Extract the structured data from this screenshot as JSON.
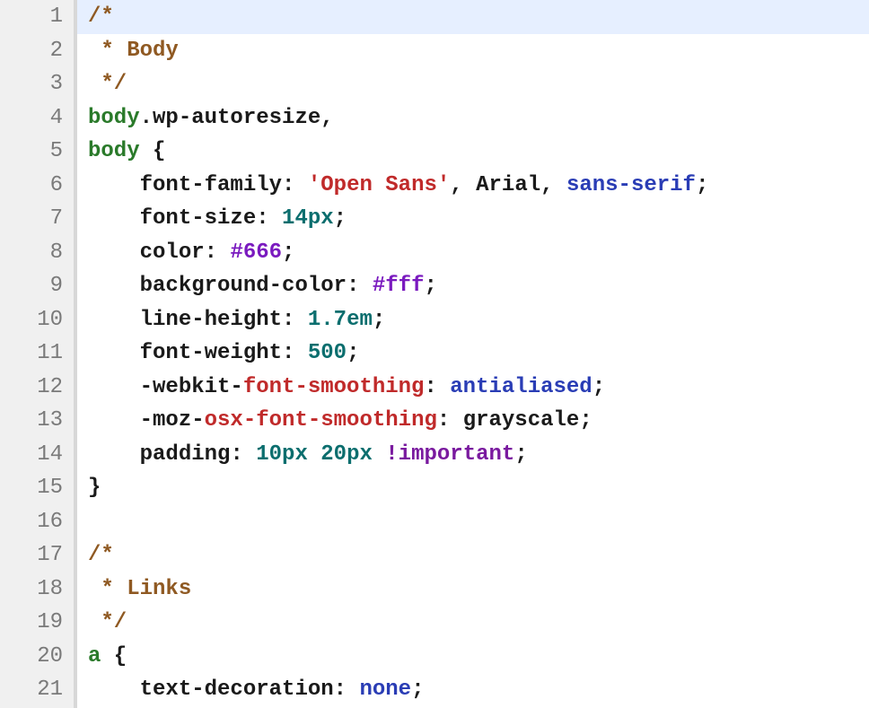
{
  "language": "css",
  "active_line": 1,
  "lines": [
    {
      "num": 1,
      "indent": 0,
      "tokens": [
        {
          "cls": "t-comment",
          "text": "/*"
        }
      ]
    },
    {
      "num": 2,
      "indent": 0,
      "tokens": [
        {
          "cls": "t-comment",
          "text": " * Body"
        }
      ]
    },
    {
      "num": 3,
      "indent": 0,
      "tokens": [
        {
          "cls": "t-comment",
          "text": " */"
        }
      ]
    },
    {
      "num": 4,
      "indent": 0,
      "tokens": [
        {
          "cls": "t-selector",
          "text": "body"
        },
        {
          "cls": "t-plain",
          "text": ".wp-autoresize,"
        }
      ]
    },
    {
      "num": 5,
      "indent": 0,
      "tokens": [
        {
          "cls": "t-selector",
          "text": "body"
        },
        {
          "cls": "t-plain",
          "text": " {"
        }
      ]
    },
    {
      "num": 6,
      "indent": 2,
      "tokens": [
        {
          "cls": "t-prop",
          "text": "    font-family"
        },
        {
          "cls": "t-punct",
          "text": ": "
        },
        {
          "cls": "t-string",
          "text": "'Open Sans'"
        },
        {
          "cls": "t-punct",
          "text": ", "
        },
        {
          "cls": "t-plain",
          "text": "Arial"
        },
        {
          "cls": "t-punct",
          "text": ", "
        },
        {
          "cls": "t-keyword",
          "text": "sans-serif"
        },
        {
          "cls": "t-punct",
          "text": ";"
        }
      ]
    },
    {
      "num": 7,
      "indent": 2,
      "tokens": [
        {
          "cls": "t-prop",
          "text": "    font-size"
        },
        {
          "cls": "t-punct",
          "text": ": "
        },
        {
          "cls": "t-number",
          "text": "14px"
        },
        {
          "cls": "t-punct",
          "text": ";"
        }
      ]
    },
    {
      "num": 8,
      "indent": 2,
      "tokens": [
        {
          "cls": "t-prop",
          "text": "    color"
        },
        {
          "cls": "t-punct",
          "text": ": "
        },
        {
          "cls": "t-hex",
          "text": "#666"
        },
        {
          "cls": "t-punct",
          "text": ";"
        }
      ]
    },
    {
      "num": 9,
      "indent": 2,
      "tokens": [
        {
          "cls": "t-prop",
          "text": "    background-color"
        },
        {
          "cls": "t-punct",
          "text": ": "
        },
        {
          "cls": "t-hex",
          "text": "#fff"
        },
        {
          "cls": "t-punct",
          "text": ";"
        }
      ]
    },
    {
      "num": 10,
      "indent": 2,
      "tokens": [
        {
          "cls": "t-prop",
          "text": "    line-height"
        },
        {
          "cls": "t-punct",
          "text": ": "
        },
        {
          "cls": "t-number",
          "text": "1.7em"
        },
        {
          "cls": "t-punct",
          "text": ";"
        }
      ]
    },
    {
      "num": 11,
      "indent": 2,
      "tokens": [
        {
          "cls": "t-prop",
          "text": "    font-weight"
        },
        {
          "cls": "t-punct",
          "text": ": "
        },
        {
          "cls": "t-number",
          "text": "500"
        },
        {
          "cls": "t-punct",
          "text": ";"
        }
      ]
    },
    {
      "num": 12,
      "indent": 2,
      "tokens": [
        {
          "cls": "t-plain",
          "text": "    -webkit-"
        },
        {
          "cls": "t-propvendor",
          "text": "font-smoothing"
        },
        {
          "cls": "t-punct",
          "text": ": "
        },
        {
          "cls": "t-keyword",
          "text": "antialiased"
        },
        {
          "cls": "t-punct",
          "text": ";"
        }
      ]
    },
    {
      "num": 13,
      "indent": 2,
      "tokens": [
        {
          "cls": "t-plain",
          "text": "    -moz-"
        },
        {
          "cls": "t-propvendor",
          "text": "osx-font-smoothing"
        },
        {
          "cls": "t-punct",
          "text": ": "
        },
        {
          "cls": "t-plain",
          "text": "grayscale"
        },
        {
          "cls": "t-punct",
          "text": ";"
        }
      ]
    },
    {
      "num": 14,
      "indent": 2,
      "tokens": [
        {
          "cls": "t-prop",
          "text": "    padding"
        },
        {
          "cls": "t-punct",
          "text": ": "
        },
        {
          "cls": "t-number",
          "text": "10px 20px "
        },
        {
          "cls": "t-important",
          "text": "!important"
        },
        {
          "cls": "t-punct",
          "text": ";"
        }
      ]
    },
    {
      "num": 15,
      "indent": 0,
      "tokens": [
        {
          "cls": "t-plain",
          "text": "}"
        }
      ]
    },
    {
      "num": 16,
      "indent": 0,
      "tokens": [
        {
          "cls": "t-plain",
          "text": ""
        }
      ]
    },
    {
      "num": 17,
      "indent": 0,
      "tokens": [
        {
          "cls": "t-comment",
          "text": "/*"
        }
      ]
    },
    {
      "num": 18,
      "indent": 0,
      "tokens": [
        {
          "cls": "t-comment",
          "text": " * Links"
        }
      ]
    },
    {
      "num": 19,
      "indent": 0,
      "tokens": [
        {
          "cls": "t-comment",
          "text": " */"
        }
      ]
    },
    {
      "num": 20,
      "indent": 0,
      "tokens": [
        {
          "cls": "t-selector",
          "text": "a"
        },
        {
          "cls": "t-plain",
          "text": " {"
        }
      ]
    },
    {
      "num": 21,
      "indent": 2,
      "tokens": [
        {
          "cls": "t-prop",
          "text": "    text-decoration"
        },
        {
          "cls": "t-punct",
          "text": ": "
        },
        {
          "cls": "t-keyword",
          "text": "none"
        },
        {
          "cls": "t-punct",
          "text": ";"
        }
      ]
    }
  ]
}
